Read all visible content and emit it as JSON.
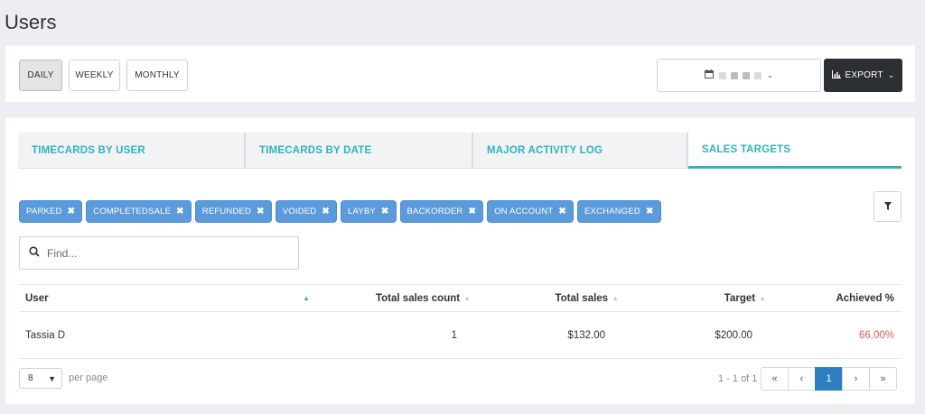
{
  "page": {
    "title": "Users"
  },
  "toolbar": {
    "periods": [
      "DAILY",
      "WEEKLY",
      "MONTHLY"
    ],
    "active_period": "DAILY",
    "export_label": "EXPORT"
  },
  "tabs": [
    {
      "label": "TIMECARDS BY USER",
      "active": false
    },
    {
      "label": "TIMECARDS BY DATE",
      "active": false
    },
    {
      "label": "MAJOR ACTIVITY LOG",
      "active": false
    },
    {
      "label": "SALES TARGETS",
      "active": true
    }
  ],
  "filters": [
    "PARKED",
    "COMPLETEDSALE",
    "REFUNDED",
    "VOIDED",
    "LAYBY",
    "BACKORDER",
    "ON ACCOUNT",
    "EXCHANGED"
  ],
  "search": {
    "placeholder": "Find...",
    "value": ""
  },
  "table": {
    "columns": [
      "User",
      "Total sales count",
      "Total sales",
      "Target",
      "Achieved %"
    ],
    "rows": [
      {
        "user": "Tassia D",
        "total_sales_count": "1",
        "total_sales": "$132.00",
        "target": "$200.00",
        "achieved": "66.00%"
      }
    ]
  },
  "pagination": {
    "per_page_value": "8",
    "per_page_label": "per page",
    "info": "1 - 1 of 1",
    "first": "«",
    "prev": "‹",
    "current": "1",
    "next": "›",
    "last": "»"
  },
  "colors": {
    "accent": "#2fb4bd",
    "chip": "#5b9bdc",
    "achieved": "#e05a5a",
    "export_bg": "#2c3034",
    "page_active": "#2d7fc2"
  }
}
